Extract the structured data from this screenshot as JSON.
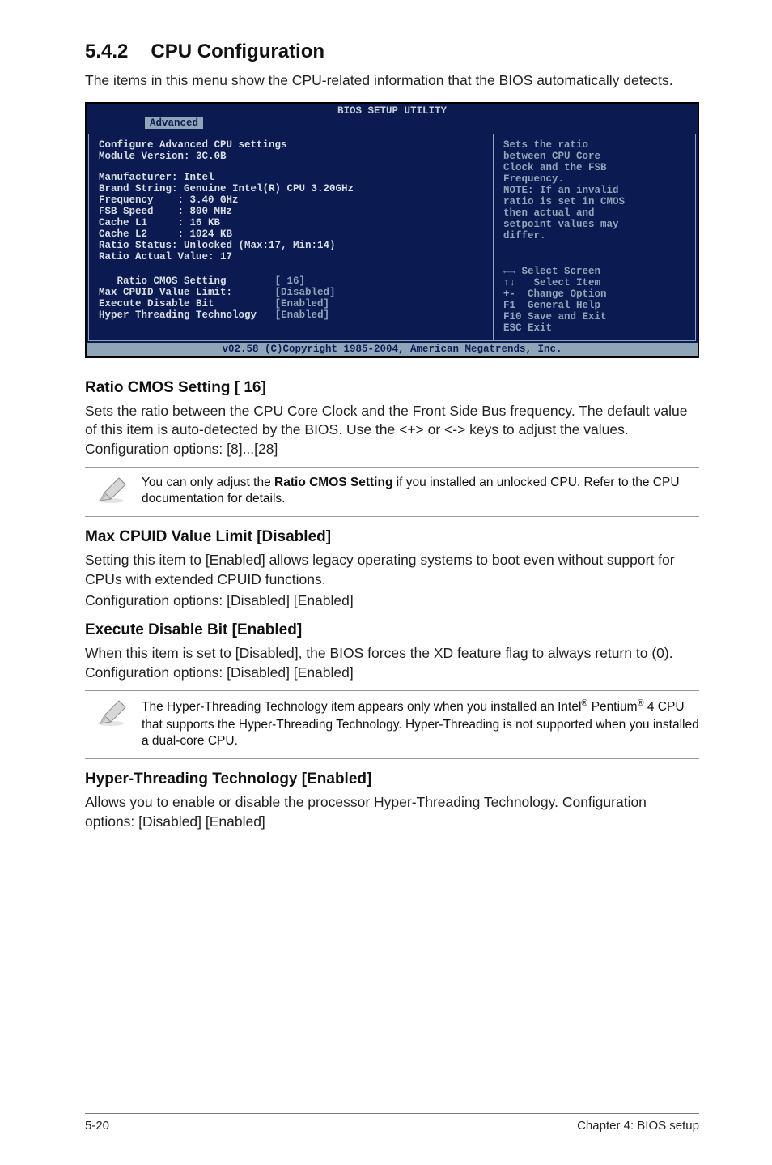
{
  "heading": {
    "number": "5.4.2",
    "title": "CPU Configuration"
  },
  "intro": "The items in this menu show the CPU-related information that the BIOS automatically detects.",
  "bios": {
    "title": "BIOS SETUP UTILITY",
    "tab": "Advanced",
    "left": {
      "line1": "Configure Advanced CPU settings",
      "line2": "Module Version: 3C.0B",
      "manufacturer": "Manufacturer: Intel",
      "brand": "Brand String: Genuine Intel(R) CPU 3.20GHz",
      "frequency": "Frequency    : 3.40 GHz",
      "fsb": "FSB Speed    : 800 MHz",
      "l1": "Cache L1     : 16 KB",
      "l2": "Cache L2     : 1024 KB",
      "ratio_status": "Ratio Status: Unlocked (Max:17, Min:14)",
      "ratio_actual": "Ratio Actual Value: 17",
      "s1_label": "   Ratio CMOS Setting",
      "s1_value": "[ 16]",
      "s2_label": "Max CPUID Value Limit:",
      "s2_value": "[Disabled]",
      "s3_label": "Execute Disable Bit",
      "s3_value": "[Enabled]",
      "s4_label": "Hyper Threading Technology",
      "s4_value": "[Enabled]"
    },
    "right": {
      "help": "Sets the ratio between CPU Core Clock and the FSB Frequency.\nNOTE: If an invalid ratio is set in CMOS then actual and setpoint values may differ.",
      "help_text_l1": "Sets the ratio",
      "help_text_l2": "between CPU Core",
      "help_text_l3": "Clock and the FSB",
      "help_text_l4": "Frequency.",
      "help_text_l5": "NOTE: If an invalid",
      "help_text_l6": "ratio is set in CMOS",
      "help_text_l7": "then actual and",
      "help_text_l8": "setpoint values may",
      "help_text_l9": "differ.",
      "k1": "←→ Select Screen",
      "k2": "↑↓   Select Item",
      "k3": "+-  Change Option",
      "k4": "F1  General Help",
      "k5": "F10 Save and Exit",
      "k6": "ESC Exit"
    },
    "footer": "v02.58 (C)Copyright 1985-2004, American Megatrends, Inc."
  },
  "sections": {
    "ratio": {
      "title": "Ratio CMOS Setting [ 16]",
      "body": "Sets the ratio between the CPU Core Clock and the Front Side Bus frequency. The default value of this item is auto-detected by the BIOS. Use the <+> or <-> keys to adjust the values. Configuration options: [8]...[28]"
    },
    "note1_pre": "You can only adjust the ",
    "note1_bold": "Ratio CMOS Setting",
    "note1_post": " if you installed an unlocked CPU. Refer to the CPU documentation for details.",
    "maxcpuid": {
      "title": "Max CPUID Value Limit [Disabled]",
      "body": "Setting this item to [Enabled] allows legacy operating systems to boot even without support for CPUs with extended CPUID functions.\nConfiguration options: [Disabled] [Enabled]",
      "body_l1": "Setting this item to [Enabled] allows legacy operating systems to boot even without support for CPUs with extended CPUID functions.",
      "body_l2": "Configuration options: [Disabled] [Enabled]"
    },
    "execdis": {
      "title": "Execute Disable Bit [Enabled]",
      "body": "When this item is set to [Disabled], the BIOS forces the XD feature flag to always return to (0). Configuration options: [Disabled] [Enabled]"
    },
    "note2_l1_pre": "The Hyper-Threading Technology item appears only when you installed an Intel",
    "note2_l1_mid": " Pentium",
    "note2_l1_post": " 4 CPU that supports the Hyper-Threading Technology. Hyper-Threading is not supported when you installed a dual-core CPU.",
    "hyper": {
      "title": "Hyper-Threading Technology [Enabled]",
      "body": "Allows you to enable or disable the processor Hyper-Threading Technology. Configuration options: [Disabled] [Enabled]"
    }
  },
  "footer": {
    "left": "5-20",
    "right": "Chapter 4: BIOS setup"
  },
  "glyphs": {
    "reg": "®"
  }
}
